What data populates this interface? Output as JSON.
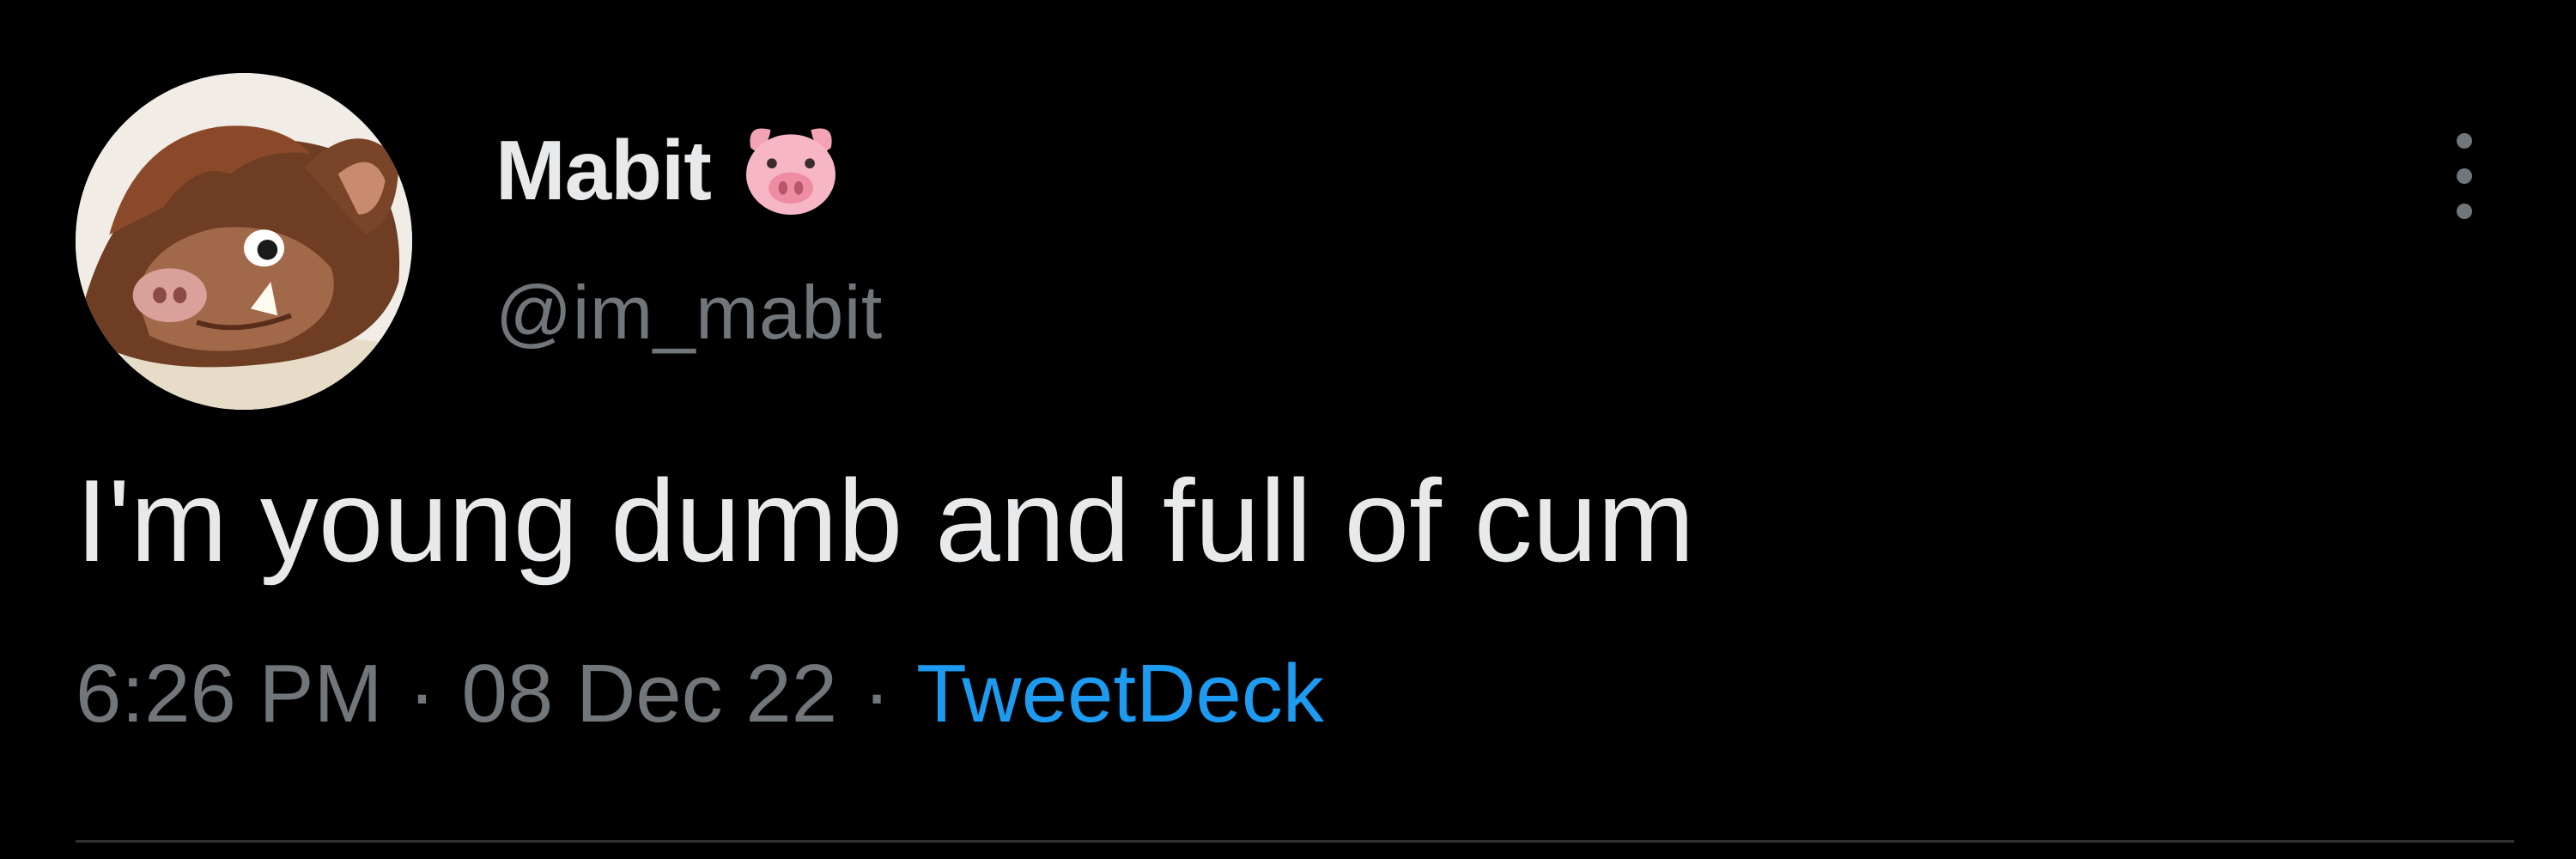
{
  "tweet": {
    "author": {
      "display_name": "Mabit",
      "name_emoji_icon": "pig-face-icon",
      "handle": "@im_mabit",
      "avatar_icon": "boar-character-avatar"
    },
    "text": "I'm young dumb and full of cum",
    "time": "6:26 PM",
    "date": "08 Dec 22",
    "source": "TweetDeck",
    "separator": "·",
    "menu_icon": "more-vertical-icon"
  },
  "colors": {
    "background": "#000000",
    "primary_text": "#e7e9ea",
    "secondary_text": "#71767b",
    "link": "#1d9bf0",
    "divider": "#2f3336"
  }
}
